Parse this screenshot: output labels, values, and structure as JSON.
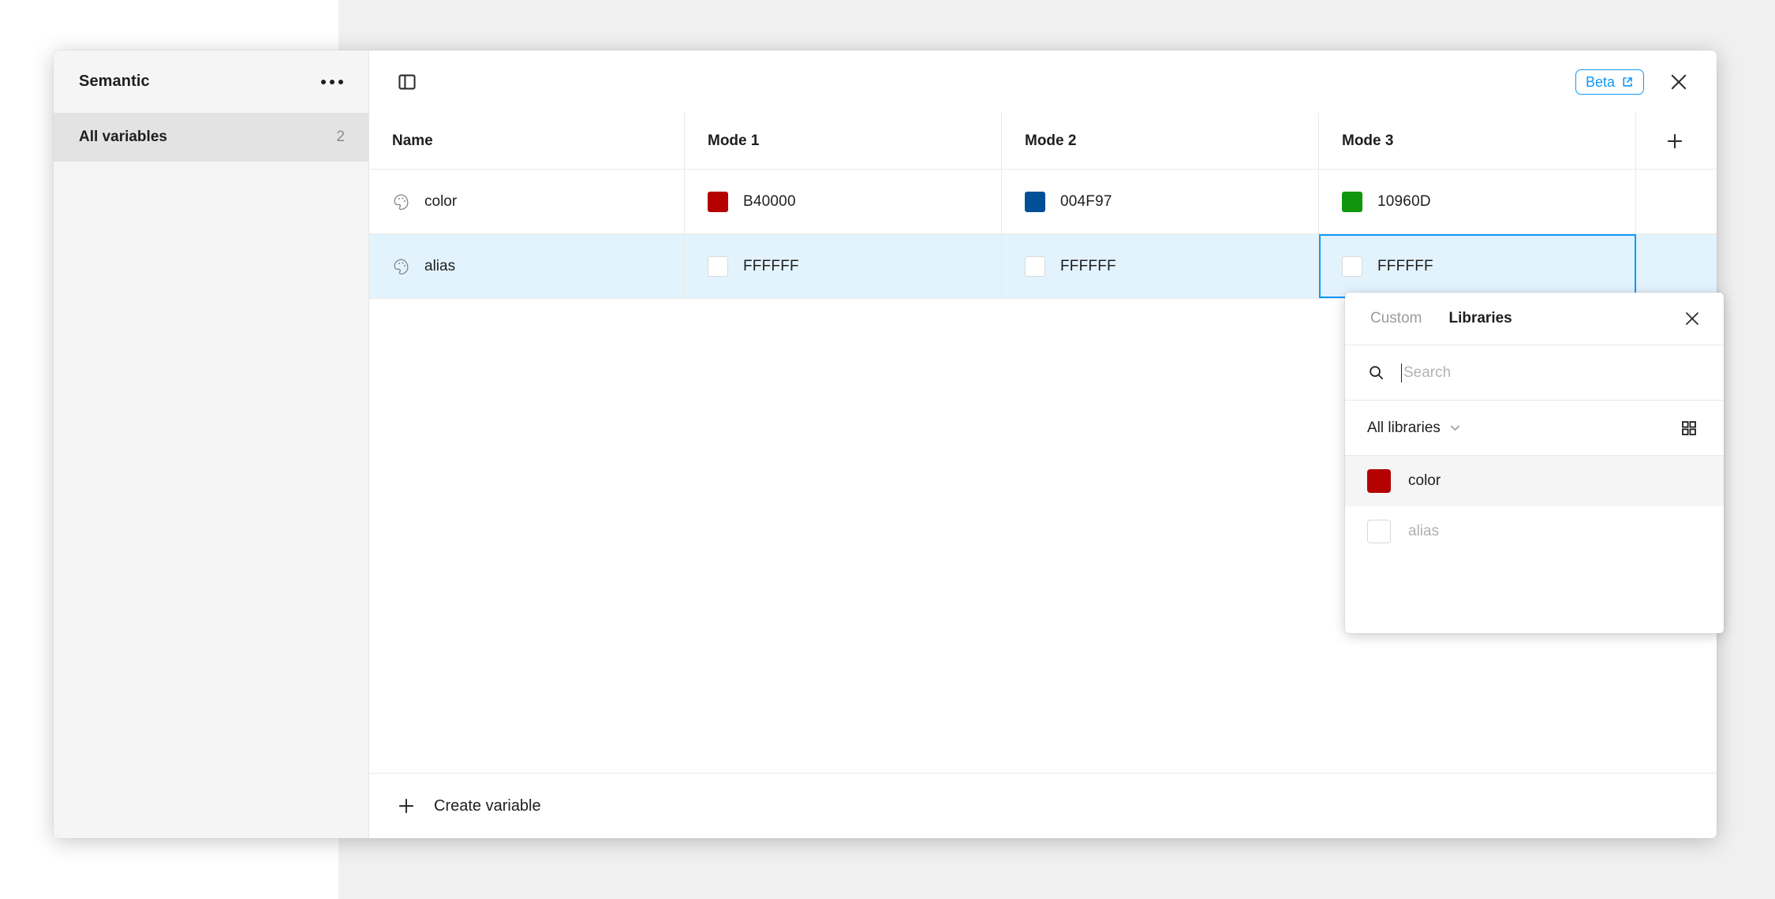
{
  "sidebar": {
    "title": "Semantic",
    "menu_icon": "more-horizontal-icon",
    "rows": [
      {
        "label": "All variables",
        "count": "2"
      }
    ]
  },
  "toolbar": {
    "panel_toggle_icon": "sidebar-panel-toggle-icon",
    "beta_label": "Beta",
    "beta_external_icon": "external-link-icon",
    "close_icon": "close-icon",
    "accent_color": "#0D99FF"
  },
  "table": {
    "columns": [
      "Name",
      "Mode 1",
      "Mode 2",
      "Mode 3"
    ],
    "add_mode_icon": "plus-icon",
    "rows": [
      {
        "type_icon": "color-palette-icon",
        "name": "color",
        "highlight": false,
        "values": [
          {
            "hex": "B40000",
            "color": "#B40000"
          },
          {
            "hex": "004F97",
            "color": "#004F97"
          },
          {
            "hex": "10960D",
            "color": "#10960D"
          }
        ]
      },
      {
        "type_icon": "color-palette-icon",
        "name": "alias",
        "highlight": true,
        "values": [
          {
            "hex": "FFFFFF",
            "color": "#FFFFFF"
          },
          {
            "hex": "FFFFFF",
            "color": "#FFFFFF"
          },
          {
            "hex": "FFFFFF",
            "color": "#FFFFFF"
          }
        ]
      }
    ],
    "selected_cell": {
      "row": 1,
      "column": 3
    },
    "create_variable_label": "Create variable",
    "create_variable_icon": "plus-icon"
  },
  "popover": {
    "tabs": [
      {
        "label": "Custom",
        "active": false
      },
      {
        "label": "Libraries",
        "active": true
      }
    ],
    "close_icon": "close-icon",
    "search": {
      "value": "",
      "placeholder": "Search",
      "icon": "search-icon"
    },
    "filter": {
      "label": "All libraries",
      "chevron_icon": "chevron-down-icon",
      "view_icon": "grid-view-icon"
    },
    "items": [
      {
        "label": "color",
        "color": "#B40000",
        "disabled": false,
        "hovered": true
      },
      {
        "label": "alias",
        "color": "#FFFFFF",
        "disabled": true,
        "hovered": false
      }
    ]
  }
}
